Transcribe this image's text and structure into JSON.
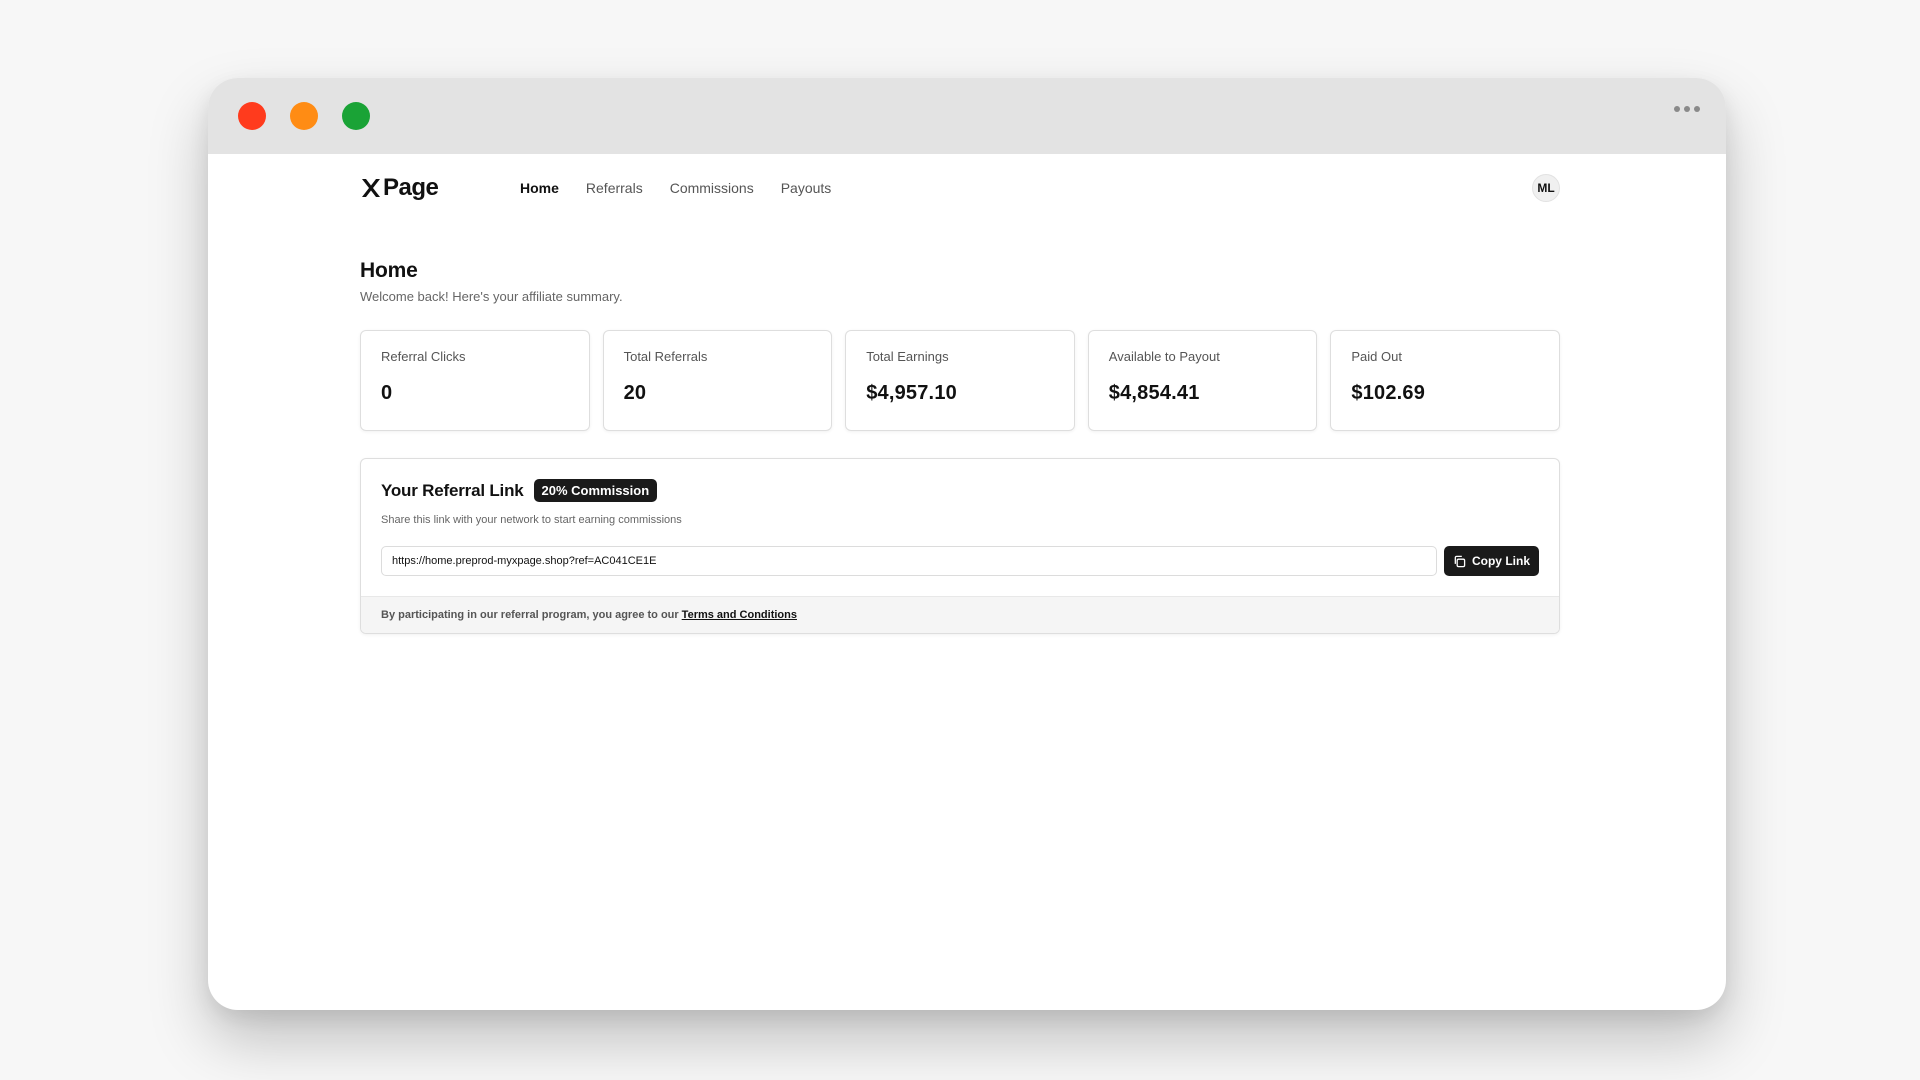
{
  "brand": {
    "name": "Page"
  },
  "nav": {
    "links": [
      {
        "label": "Home",
        "active": true
      },
      {
        "label": "Referrals",
        "active": false
      },
      {
        "label": "Commissions",
        "active": false
      },
      {
        "label": "Payouts",
        "active": false
      }
    ],
    "avatar_initials": "ML"
  },
  "page": {
    "title": "Home",
    "subtitle": "Welcome back! Here's your affiliate summary."
  },
  "stats": [
    {
      "label": "Referral Clicks",
      "value": "0"
    },
    {
      "label": "Total Referrals",
      "value": "20"
    },
    {
      "label": "Total Earnings",
      "value": "$4,957.10"
    },
    {
      "label": "Available to Payout",
      "value": "$4,854.41"
    },
    {
      "label": "Paid Out",
      "value": "$102.69"
    }
  ],
  "referral": {
    "title": "Your Referral Link",
    "badge": "20% Commission",
    "description": "Share this link with your network to start earning commissions",
    "link": "https://home.preprod-myxpage.shop?ref=AC041CE1E",
    "copy_label": "Copy Link",
    "footer_text": "By participating in our referral program, you agree to our",
    "terms_label": "Terms and Conditions"
  },
  "colors": {
    "traffic_red": "#ff3b1d",
    "traffic_orange": "#ff8c14",
    "traffic_green": "#1aa336",
    "dark": "#1a1a1a"
  },
  "icons": {
    "window_menu": "more-horizontal-icon",
    "logo": "x-logo-icon",
    "copy": "copy-icon"
  }
}
